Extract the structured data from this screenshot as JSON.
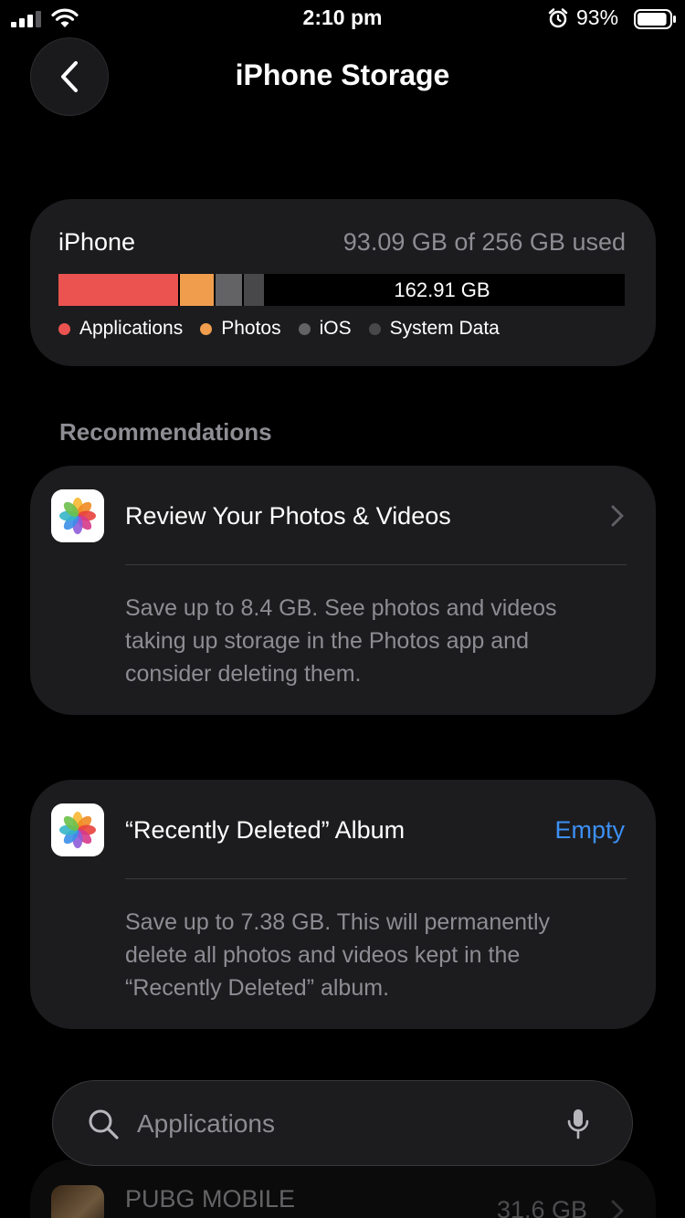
{
  "status_bar": {
    "time": "2:10 pm",
    "battery_percent": "93%",
    "battery_level": 0.93
  },
  "header": {
    "title": "iPhone Storage"
  },
  "storage": {
    "device": "iPhone",
    "used_summary": "93.09 GB of 256 GB used",
    "free_label": "162.91 GB",
    "legend": [
      {
        "label": "Applications",
        "color": "#eb5350"
      },
      {
        "label": "Photos",
        "color": "#f09e4e"
      },
      {
        "label": "iOS",
        "color": "#636366"
      },
      {
        "label": "System Data",
        "color": "#48484a"
      }
    ]
  },
  "recommendations": {
    "header": "Recommendations",
    "items": [
      {
        "title": "Review Your Photos & Videos",
        "description": "Save up to 8.4 GB. See photos and videos taking up storage in the Photos app and consider deleting them."
      },
      {
        "title": "“Recently Deleted” Album",
        "action": "Empty",
        "description": "Save up to 7.38 GB. This will permanently delete all photos and videos kept in the “Recently Deleted” album."
      }
    ]
  },
  "search": {
    "placeholder": "Applications"
  },
  "apps": [
    {
      "name": "PUBG MOBILE",
      "size": "31.6 GB"
    }
  ],
  "colors": {
    "accent": "#3d8ff5",
    "card": "#1c1c1e",
    "secondary_text": "#8d8d93"
  }
}
